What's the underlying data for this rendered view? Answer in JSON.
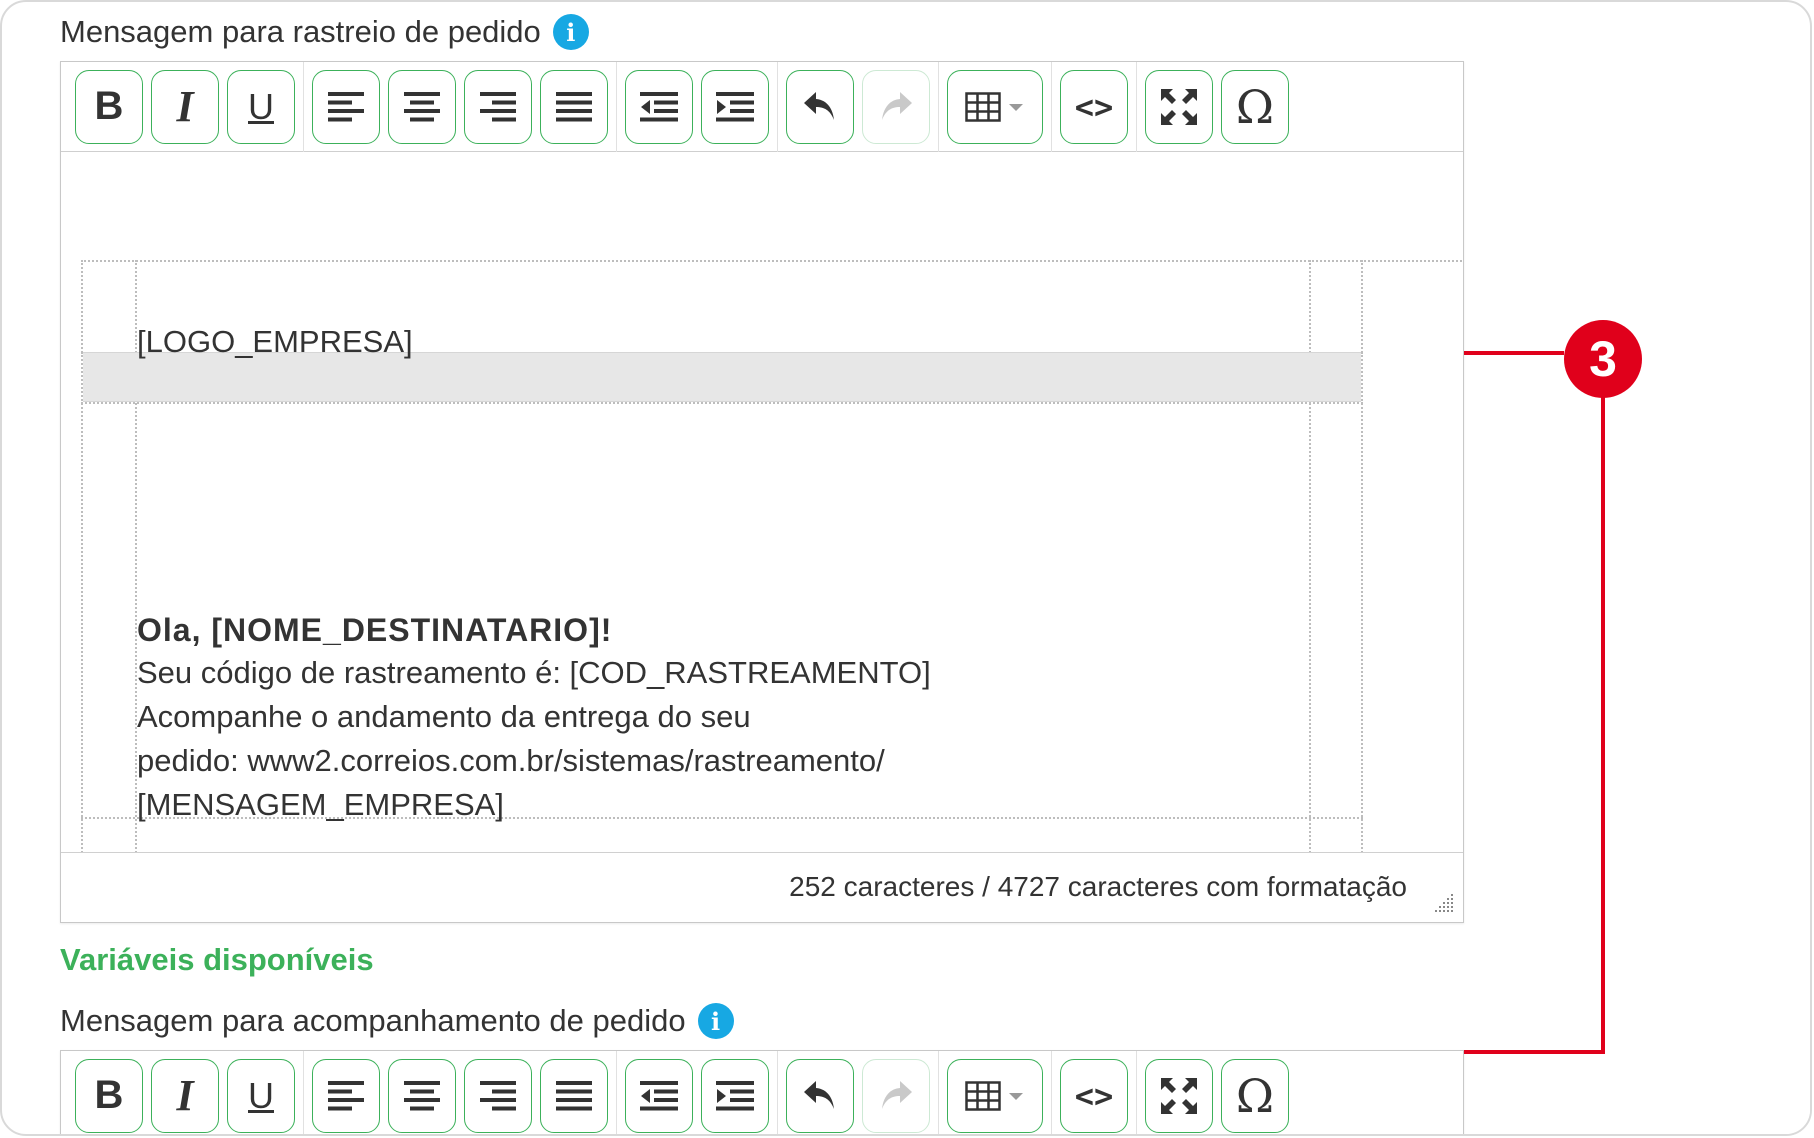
{
  "tracking_message": {
    "label": "Mensagem para rastreio de pedido",
    "content": {
      "logo": "[LOGO_EMPRESA]",
      "greeting": "Ola, [NOME_DESTINATARIO]!",
      "line1": "Seu código de rastreamento é: [COD_RASTREAMENTO]",
      "line2": "Acompanhe o andamento da entrega do seu",
      "line3": "pedido: www2.correios.com.br/sistemas/rastreamento/",
      "line4": "[MENSAGEM_EMPRESA]"
    },
    "char_count": "252 caracteres / 4727 caracteres com formatação"
  },
  "variables_heading": "Variáveis disponíveis",
  "follow_up_message": {
    "label": "Mensagem para acompanhamento de pedido"
  },
  "toolbar": {
    "bold": "B",
    "italic": "I",
    "underline": "U",
    "source_code": "<>",
    "special_char": "Ω",
    "redo_enabled": false
  },
  "callout": {
    "number": "3",
    "color": "#e0001b"
  },
  "colors": {
    "button_border": "#3cb15a",
    "heading_green": "#3cb15a",
    "info_blue": "#17a8e3"
  }
}
